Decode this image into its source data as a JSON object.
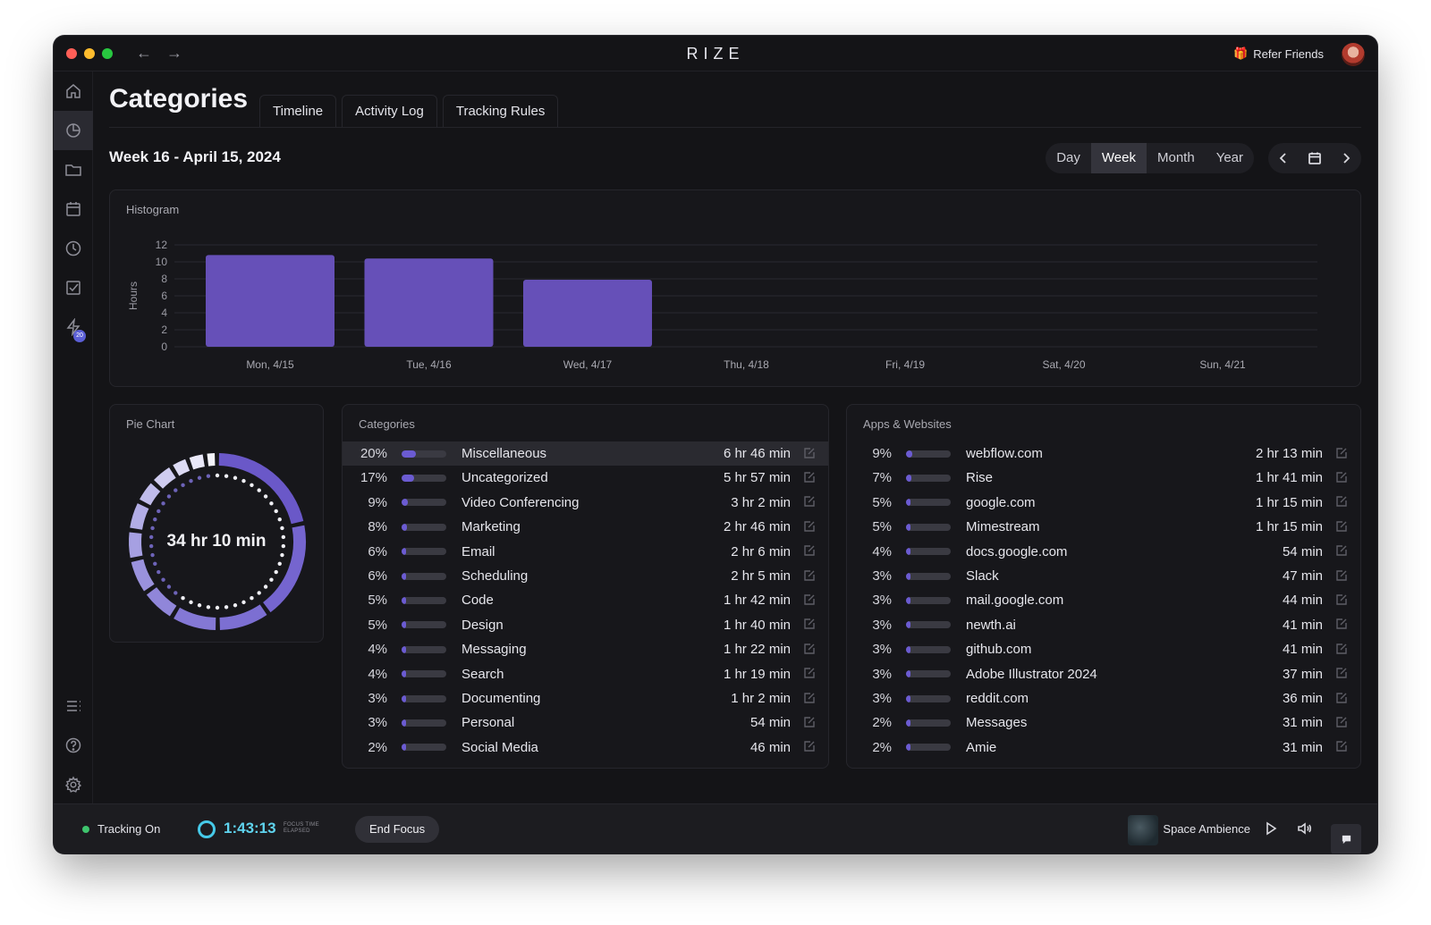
{
  "app": {
    "title": "RIZE",
    "refer_label": "Refer Friends"
  },
  "sidebar": {
    "items": [
      {
        "name": "home",
        "icon": "home-icon"
      },
      {
        "name": "categories",
        "icon": "pie-chart-icon",
        "active": true
      },
      {
        "name": "projects",
        "icon": "folder-icon"
      },
      {
        "name": "calendar",
        "icon": "calendar-icon"
      },
      {
        "name": "history",
        "icon": "clock-icon"
      },
      {
        "name": "tasks",
        "icon": "checkbox-icon"
      },
      {
        "name": "automations",
        "icon": "bolt-icon",
        "badge": "20"
      }
    ],
    "bottom": [
      {
        "name": "menu",
        "icon": "list-icon"
      },
      {
        "name": "help",
        "icon": "help-icon"
      },
      {
        "name": "settings",
        "icon": "gear-icon"
      }
    ]
  },
  "page": {
    "title": "Categories",
    "tabs": [
      "Timeline",
      "Activity Log",
      "Tracking Rules"
    ],
    "week_label": "Week 16 - April 15, 2024",
    "periods": [
      "Day",
      "Week",
      "Month",
      "Year"
    ],
    "active_period": "Week"
  },
  "histogram": {
    "title": "Histogram"
  },
  "chart_data": {
    "type": "bar",
    "ylabel": "Hours",
    "ylim": [
      0,
      12
    ],
    "yticks": [
      0,
      2,
      4,
      6,
      8,
      10,
      12
    ],
    "categories": [
      "Mon, 4/15",
      "Tue, 4/16",
      "Wed, 4/17",
      "Thu, 4/18",
      "Fri, 4/19",
      "Sat, 4/20",
      "Sun, 4/21"
    ],
    "values": [
      10.8,
      10.4,
      7.9,
      0,
      0,
      0,
      0
    ],
    "grid": true,
    "color": "#6650b8"
  },
  "pie": {
    "title": "Pie Chart",
    "total": "34 hr 10 min"
  },
  "categories_panel": {
    "title": "Categories",
    "rows": [
      {
        "pct": "20%",
        "name": "Miscellaneous",
        "time": "6 hr 46 min",
        "fill": 0.2
      },
      {
        "pct": "17%",
        "name": "Uncategorized",
        "time": "5 hr 57 min",
        "fill": 0.17
      },
      {
        "pct": "9%",
        "name": "Video Conferencing",
        "time": "3 hr 2 min",
        "fill": 0.09
      },
      {
        "pct": "8%",
        "name": "Marketing",
        "time": "2 hr 46 min",
        "fill": 0.08
      },
      {
        "pct": "6%",
        "name": "Email",
        "time": "2 hr 6 min",
        "fill": 0.06
      },
      {
        "pct": "6%",
        "name": "Scheduling",
        "time": "2 hr 5 min",
        "fill": 0.06
      },
      {
        "pct": "5%",
        "name": "Code",
        "time": "1 hr 42 min",
        "fill": 0.05
      },
      {
        "pct": "5%",
        "name": "Design",
        "time": "1 hr 40 min",
        "fill": 0.05
      },
      {
        "pct": "4%",
        "name": "Messaging",
        "time": "1 hr 22 min",
        "fill": 0.04
      },
      {
        "pct": "4%",
        "name": "Search",
        "time": "1 hr 19 min",
        "fill": 0.04
      },
      {
        "pct": "3%",
        "name": "Documenting",
        "time": "1 hr 2 min",
        "fill": 0.03
      },
      {
        "pct": "3%",
        "name": "Personal",
        "time": "54 min",
        "fill": 0.03
      },
      {
        "pct": "2%",
        "name": "Social Media",
        "time": "46 min",
        "fill": 0.02
      }
    ]
  },
  "apps_panel": {
    "title": "Apps & Websites",
    "rows": [
      {
        "pct": "9%",
        "name": "webflow.com",
        "time": "2 hr 13 min",
        "fill": 0.09
      },
      {
        "pct": "7%",
        "name": "Rise",
        "time": "1 hr 41 min",
        "fill": 0.07
      },
      {
        "pct": "5%",
        "name": "google.com",
        "time": "1 hr 15 min",
        "fill": 0.05
      },
      {
        "pct": "5%",
        "name": "Mimestream",
        "time": "1 hr 15 min",
        "fill": 0.05
      },
      {
        "pct": "4%",
        "name": "docs.google.com",
        "time": "54 min",
        "fill": 0.04
      },
      {
        "pct": "3%",
        "name": "Slack",
        "time": "47 min",
        "fill": 0.03
      },
      {
        "pct": "3%",
        "name": "mail.google.com",
        "time": "44 min",
        "fill": 0.03
      },
      {
        "pct": "3%",
        "name": "newth.ai",
        "time": "41 min",
        "fill": 0.03
      },
      {
        "pct": "3%",
        "name": "github.com",
        "time": "41 min",
        "fill": 0.03
      },
      {
        "pct": "3%",
        "name": "Adobe Illustrator 2024",
        "time": "37 min",
        "fill": 0.03
      },
      {
        "pct": "3%",
        "name": "reddit.com",
        "time": "36 min",
        "fill": 0.03
      },
      {
        "pct": "2%",
        "name": "Messages",
        "time": "31 min",
        "fill": 0.02
      },
      {
        "pct": "2%",
        "name": "Amie",
        "time": "31 min",
        "fill": 0.02
      }
    ]
  },
  "footer": {
    "tracking_label": "Tracking On",
    "focus_time": "1:43:13",
    "focus_caption_1": "FOCUS TIME",
    "focus_caption_2": "ELAPSED",
    "end_focus_label": "End Focus",
    "ambience_label": "Space Ambience"
  }
}
